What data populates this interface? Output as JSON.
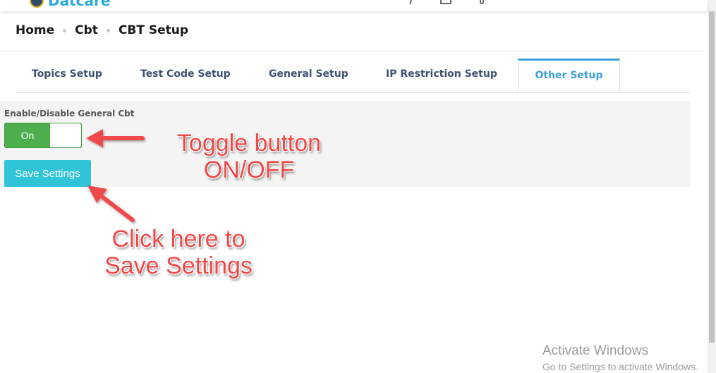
{
  "app": {
    "name": "Datcare"
  },
  "breadcrumb": [
    "Home",
    "Cbt",
    "CBT Setup"
  ],
  "tabs": [
    {
      "label": "Topics Setup",
      "active": false
    },
    {
      "label": "Test Code Setup",
      "active": false
    },
    {
      "label": "General Setup",
      "active": false
    },
    {
      "label": "IP Restriction Setup",
      "active": false
    },
    {
      "label": "Other Setup",
      "active": true
    }
  ],
  "settings": {
    "toggle_label": "Enable/Disable General Cbt",
    "toggle_state": "On",
    "save_label": "Save Settings"
  },
  "annotations": {
    "toggle_note_line1": "Toggle button",
    "toggle_note_line2": "ON/OFF",
    "save_note_line1": "Click here to",
    "save_note_line2": "Save Settings"
  },
  "watermark": {
    "title": "Activate Windows",
    "subtitle": "Go to Settings to activate Windows."
  },
  "colors": {
    "accent": "#3aa0d8",
    "toggle_on": "#4cae4c",
    "save_button": "#2fc4d8",
    "annotation": "#f04848"
  },
  "icons": [
    "app-logo-icon",
    "search-icon",
    "document-icon",
    "bell-icon",
    "menu-icon",
    "arrow-icon"
  ]
}
